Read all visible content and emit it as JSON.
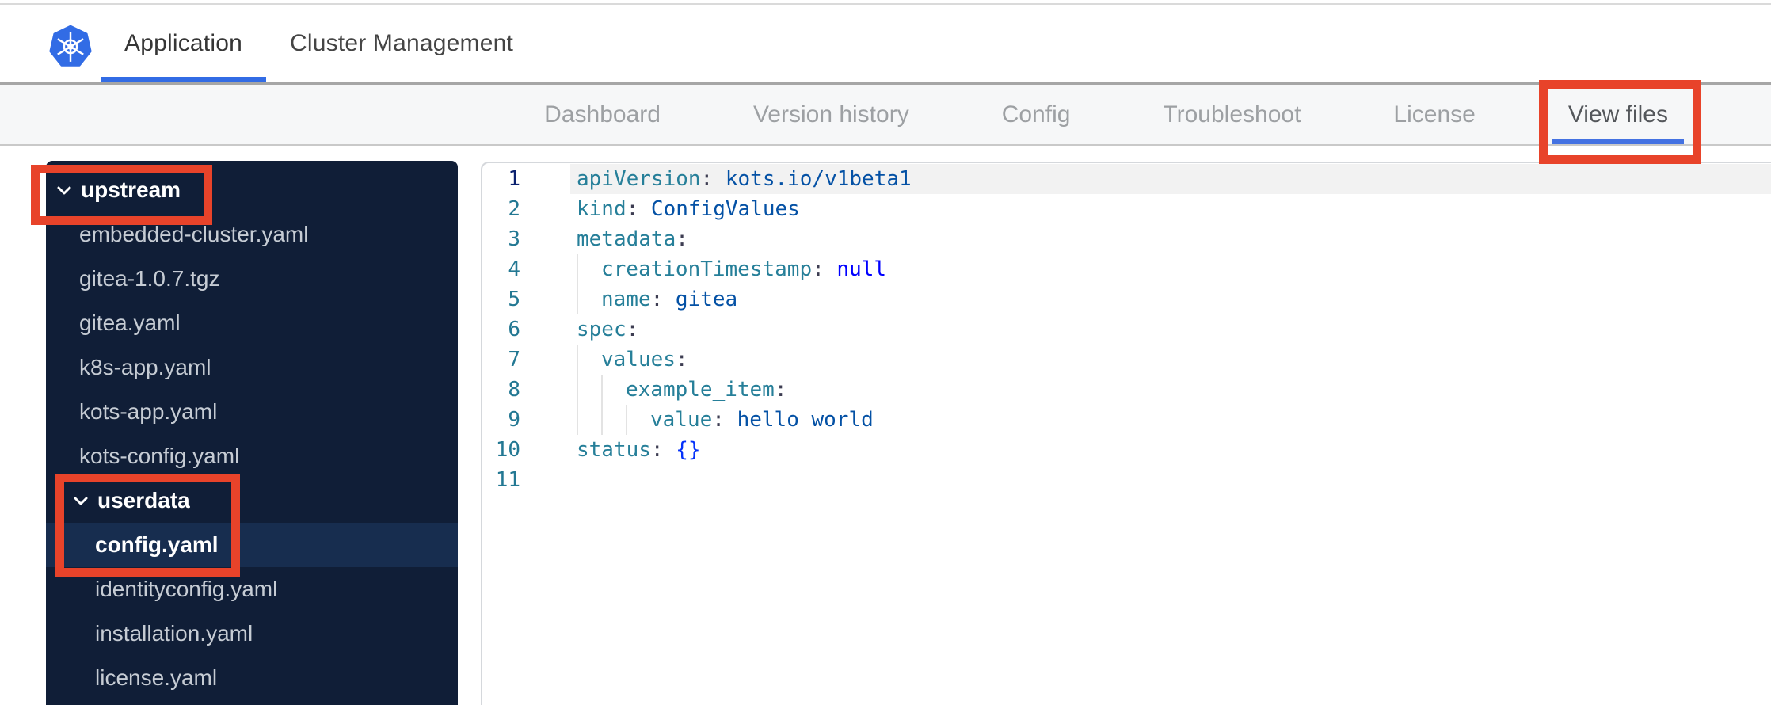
{
  "header": {
    "tabs": [
      {
        "label": "Application",
        "active": true
      },
      {
        "label": "Cluster Management",
        "active": false
      }
    ]
  },
  "nav": {
    "items": [
      {
        "label": "Dashboard",
        "active": false
      },
      {
        "label": "Version history",
        "active": false
      },
      {
        "label": "Config",
        "active": false
      },
      {
        "label": "Troubleshoot",
        "active": false
      },
      {
        "label": "License",
        "active": false
      },
      {
        "label": "View files",
        "active": true
      }
    ]
  },
  "file_tree": {
    "items": [
      {
        "type": "folder",
        "label": "upstream",
        "level": 0,
        "expanded": true
      },
      {
        "type": "file",
        "label": "embedded-cluster.yaml",
        "level": 1
      },
      {
        "type": "file",
        "label": "gitea-1.0.7.tgz",
        "level": 1
      },
      {
        "type": "file",
        "label": "gitea.yaml",
        "level": 1
      },
      {
        "type": "file",
        "label": "k8s-app.yaml",
        "level": 1
      },
      {
        "type": "file",
        "label": "kots-app.yaml",
        "level": 1
      },
      {
        "type": "file",
        "label": "kots-config.yaml",
        "level": 1
      },
      {
        "type": "folder",
        "label": "userdata",
        "level": 1,
        "expanded": true
      },
      {
        "type": "file",
        "label": "config.yaml",
        "level": 2,
        "selected": true
      },
      {
        "type": "file",
        "label": "identityconfig.yaml",
        "level": 2
      },
      {
        "type": "file",
        "label": "installation.yaml",
        "level": 2
      },
      {
        "type": "file",
        "label": "license.yaml",
        "level": 2
      }
    ]
  },
  "editor": {
    "language": "yaml",
    "active_line": 1,
    "lines": [
      {
        "num": "1",
        "tokens": [
          [
            "key",
            "apiVersion"
          ],
          [
            "colon",
            ":"
          ],
          [
            "value",
            " kots.io/v1beta1"
          ]
        ]
      },
      {
        "num": "2",
        "tokens": [
          [
            "key",
            "kind"
          ],
          [
            "colon",
            ":"
          ],
          [
            "value",
            " ConfigValues"
          ]
        ]
      },
      {
        "num": "3",
        "tokens": [
          [
            "key",
            "metadata"
          ],
          [
            "colon",
            ":"
          ]
        ]
      },
      {
        "num": "4",
        "tokens": [
          [
            "guide",
            ""
          ],
          [
            "key",
            "creationTimestamp"
          ],
          [
            "colon",
            ":"
          ],
          [
            "keyword",
            " null"
          ]
        ]
      },
      {
        "num": "5",
        "tokens": [
          [
            "guide",
            ""
          ],
          [
            "key",
            "name"
          ],
          [
            "colon",
            ":"
          ],
          [
            "value",
            " gitea"
          ]
        ]
      },
      {
        "num": "6",
        "tokens": [
          [
            "key",
            "spec"
          ],
          [
            "colon",
            ":"
          ]
        ]
      },
      {
        "num": "7",
        "tokens": [
          [
            "guide",
            ""
          ],
          [
            "key",
            "values"
          ],
          [
            "colon",
            ":"
          ]
        ]
      },
      {
        "num": "8",
        "tokens": [
          [
            "guide",
            ""
          ],
          [
            "guide",
            ""
          ],
          [
            "key",
            "example_item"
          ],
          [
            "colon",
            ":"
          ]
        ]
      },
      {
        "num": "9",
        "tokens": [
          [
            "guide",
            ""
          ],
          [
            "guide",
            ""
          ],
          [
            "guide",
            ""
          ],
          [
            "key",
            "value"
          ],
          [
            "colon",
            ":"
          ],
          [
            "value",
            " hello world"
          ]
        ]
      },
      {
        "num": "10",
        "tokens": [
          [
            "key",
            "status"
          ],
          [
            "colon",
            ":"
          ],
          [
            "bracket",
            " {}"
          ]
        ]
      },
      {
        "num": "11",
        "tokens": []
      }
    ],
    "raw": "apiVersion: kots.io/v1beta1\nkind: ConfigValues\nmetadata:\n  creationTimestamp: null\n  name: gitea\nspec:\n  values:\n    example_item:\n      value: hello world\nstatus: {}\n"
  },
  "annotations": {
    "color": "#e8432a",
    "boxes": [
      {
        "target": "view-files-tab"
      },
      {
        "target": "upstream-folder"
      },
      {
        "target": "userdata-folder-and-config-yaml"
      }
    ]
  },
  "colors": {
    "accent_blue": "#326ce5",
    "annotation_red": "#e8432a",
    "sidebar_bg": "#101e37",
    "sidebar_selected": "#172d4f",
    "key_teal": "#267f99",
    "value_blue": "#0451a5"
  }
}
